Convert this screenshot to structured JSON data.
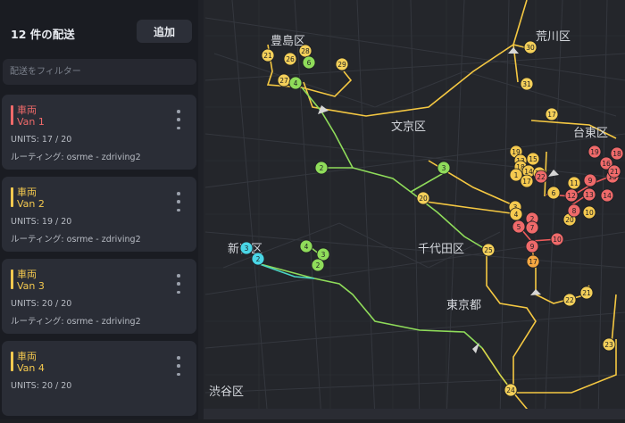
{
  "sidebar": {
    "title": "12 件の配送",
    "add_label": "追加",
    "filter_placeholder": "配送をフィルター",
    "vehicles": [
      {
        "label": "車両",
        "name": "Van 1",
        "units": "UNITS: 17 / 20",
        "routing": "ルーティング: osrme - zdriving2",
        "color": "#ef6a6a"
      },
      {
        "label": "車両",
        "name": "Van 2",
        "units": "UNITS: 19 / 20",
        "routing": "ルーティング: osrme - zdriving2",
        "color": "#f4c94f"
      },
      {
        "label": "車両",
        "name": "Van 3",
        "units": "UNITS: 20 / 20",
        "routing": "ルーティング: osrme - zdriving2",
        "color": "#f4c94f"
      },
      {
        "label": "車両",
        "name": "Van 4",
        "units": "UNITS: 20 / 20",
        "routing": "",
        "color": "#f4c94f"
      }
    ]
  },
  "map": {
    "wards": [
      "豊島区",
      "荒川区",
      "文京区",
      "台東区",
      "新宿区",
      "千代田区",
      "東京都",
      "渋谷区"
    ],
    "route_colors": {
      "yellow": "#f5c842",
      "green": "#8fdc5a",
      "teal": "#4ad6c6",
      "red": "#ef5b5b",
      "orange": "#f5a742"
    },
    "stops": [
      {
        "n": "21",
        "c": "#f4d05a"
      },
      {
        "n": "26",
        "c": "#f4d05a"
      },
      {
        "n": "28",
        "c": "#f4d05a"
      },
      {
        "n": "6",
        "c": "#8fdc5a"
      },
      {
        "n": "27",
        "c": "#f4d05a"
      },
      {
        "n": "4",
        "c": "#8fdc5a"
      },
      {
        "n": "29",
        "c": "#f4d05a"
      },
      {
        "n": "30",
        "c": "#f4d05a"
      },
      {
        "n": "31",
        "c": "#f4d05a"
      },
      {
        "n": "2",
        "c": "#8fdc5a"
      },
      {
        "n": "3",
        "c": "#8fdc5a"
      },
      {
        "n": "20",
        "c": "#f4d05a"
      },
      {
        "n": "17",
        "c": "#f4d05a"
      },
      {
        "n": "4",
        "c": "#8fdc5a"
      },
      {
        "n": "3",
        "c": "#8fdc5a"
      },
      {
        "n": "2",
        "c": "#8fdc5a"
      },
      {
        "n": "3",
        "c": "#4ad6e6"
      },
      {
        "n": "2",
        "c": "#4ad6e6"
      },
      {
        "n": "25",
        "c": "#f4d05a"
      },
      {
        "n": "17",
        "c": "#f5a742"
      },
      {
        "n": "21",
        "c": "#f4d05a"
      },
      {
        "n": "22",
        "c": "#f4d05a"
      },
      {
        "n": "23",
        "c": "#f4d05a"
      },
      {
        "n": "24",
        "c": "#f4d05a"
      },
      {
        "n": "19",
        "c": "#f4c94f"
      },
      {
        "n": "13",
        "c": "#f4c94f"
      },
      {
        "n": "15",
        "c": "#f4c94f"
      },
      {
        "n": "18",
        "c": "#f4c94f"
      },
      {
        "n": "14",
        "c": "#f4c94f"
      },
      {
        "n": "16",
        "c": "#f4c94f"
      },
      {
        "n": "1",
        "c": "#f4c94f"
      },
      {
        "n": "22",
        "c": "#ef6a6a"
      },
      {
        "n": "17",
        "c": "#f4c94f"
      },
      {
        "n": "6",
        "c": "#f4c94f"
      },
      {
        "n": "3",
        "c": "#f4c94f"
      },
      {
        "n": "2",
        "c": "#ef6a6a"
      },
      {
        "n": "5",
        "c": "#ef6a6a"
      },
      {
        "n": "7",
        "c": "#ef6a6a"
      },
      {
        "n": "9",
        "c": "#ef6a6a"
      },
      {
        "n": "10",
        "c": "#ef6a6a"
      },
      {
        "n": "11",
        "c": "#f4c94f"
      },
      {
        "n": "12",
        "c": "#ef6a6a"
      },
      {
        "n": "13",
        "c": "#ef6a6a"
      },
      {
        "n": "14",
        "c": "#ef6a6a"
      },
      {
        "n": "15",
        "c": "#ef6a6a"
      },
      {
        "n": "16",
        "c": "#ef6a6a"
      },
      {
        "n": "19",
        "c": "#ef6a6a"
      },
      {
        "n": "18",
        "c": "#ef6a6a"
      },
      {
        "n": "21",
        "c": "#ef6a6a"
      },
      {
        "n": "20",
        "c": "#f4c94f"
      },
      {
        "n": "10",
        "c": "#f4c94f"
      },
      {
        "n": "8",
        "c": "#ef6a6a"
      },
      {
        "n": "9",
        "c": "#ef6a6a"
      },
      {
        "n": "4",
        "c": "#f4c94f"
      }
    ]
  }
}
